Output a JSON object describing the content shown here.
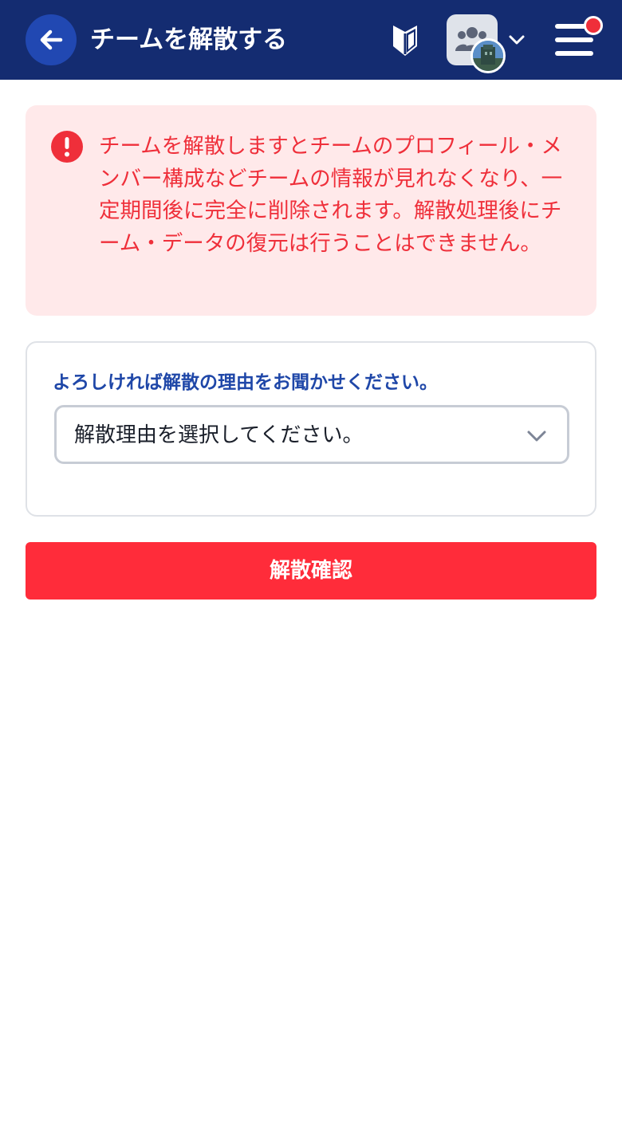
{
  "header": {
    "title": "チームを解散する",
    "back_icon": "arrow-left-icon",
    "beginner_icon": "beginner-mark-icon",
    "team_icon": "users-group-icon",
    "switch_icon": "chevron-down-icon",
    "menu_icon": "hamburger-menu-icon",
    "has_notification": true
  },
  "alert": {
    "icon": "exclamation-circle-icon",
    "message": "チームを解散しますとチームのプロフィール・メンバー構成などチームの情報が見れなくなり、一定期間後に完全に削除されます。解散処理後にチーム・データの復元は行うことはできません。"
  },
  "reason": {
    "label": "よろしければ解散の理由をお聞かせください。",
    "selected_value": "解散理由を選択してください。"
  },
  "actions": {
    "confirm_label": "解散確認"
  },
  "colors": {
    "header_bg": "#142c71",
    "accent_blue": "#1f47a8",
    "danger": "#ff2c3a",
    "alert_bg": "#ffe9ea"
  }
}
